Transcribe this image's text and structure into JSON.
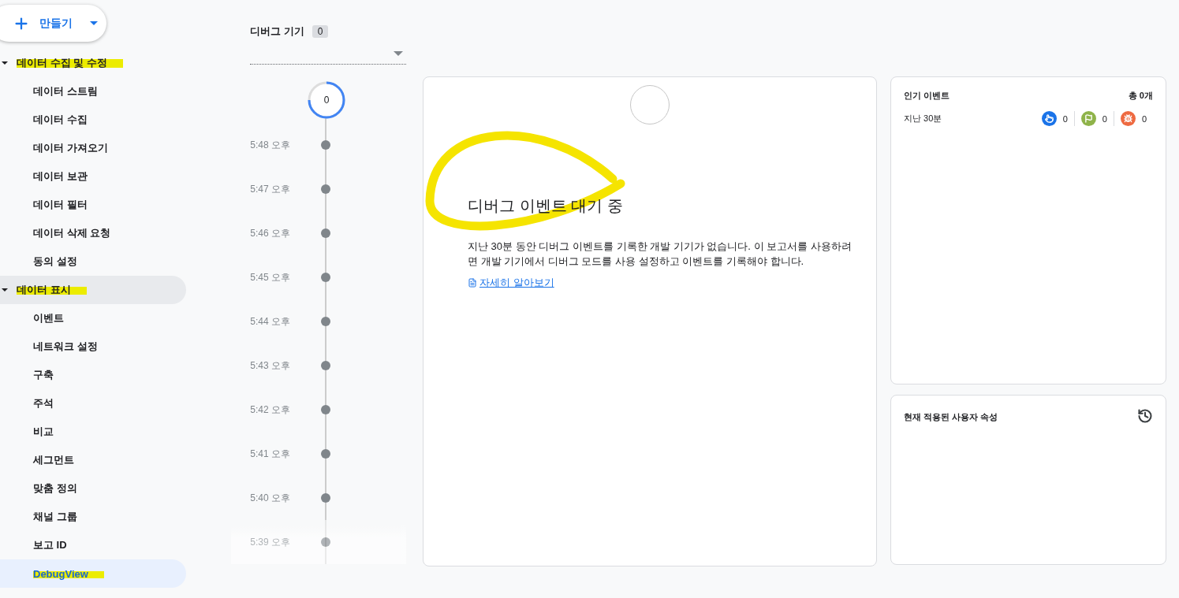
{
  "create_button": {
    "label": "만들기"
  },
  "nav": [
    {
      "label": "데이터 수집 및 수정",
      "expanded": true,
      "hovered": false,
      "marked": true,
      "children": [
        {
          "label": "데이터 스트림",
          "selected": false,
          "marked": false
        },
        {
          "label": "데이터 수집",
          "selected": false,
          "marked": false
        },
        {
          "label": "데이터 가져오기",
          "selected": false,
          "marked": false
        },
        {
          "label": "데이터 보관",
          "selected": false,
          "marked": false
        },
        {
          "label": "데이터 필터",
          "selected": false,
          "marked": false
        },
        {
          "label": "데이터 삭제 요청",
          "selected": false,
          "marked": false
        },
        {
          "label": "동의 설정",
          "selected": false,
          "marked": false
        }
      ]
    },
    {
      "label": "데이터 표시",
      "expanded": true,
      "hovered": true,
      "marked": true,
      "children": [
        {
          "label": "이벤트",
          "selected": false,
          "marked": false
        },
        {
          "label": "네트워크 설정",
          "selected": false,
          "marked": false
        },
        {
          "label": "구축",
          "selected": false,
          "marked": false
        },
        {
          "label": "주석",
          "selected": false,
          "marked": false
        },
        {
          "label": "비교",
          "selected": false,
          "marked": false
        },
        {
          "label": "세그먼트",
          "selected": false,
          "marked": false
        },
        {
          "label": "맞춤 정의",
          "selected": false,
          "marked": false
        },
        {
          "label": "채널 그룹",
          "selected": false,
          "marked": false
        },
        {
          "label": "보고 ID",
          "selected": false,
          "marked": false
        },
        {
          "label": "DebugView",
          "selected": true,
          "marked": true
        }
      ]
    }
  ],
  "debug_devices": {
    "label": "디버그 기기",
    "count": "0"
  },
  "timeline": {
    "count": "0",
    "times": [
      {
        "label": "5:48 오후",
        "faded": false
      },
      {
        "label": "5:47 오후",
        "faded": false
      },
      {
        "label": "5:46 오후",
        "faded": false
      },
      {
        "label": "5:45 오후",
        "faded": false
      },
      {
        "label": "5:44 오후",
        "faded": false
      },
      {
        "label": "5:43 오후",
        "faded": false
      },
      {
        "label": "5:42 오후",
        "faded": false
      },
      {
        "label": "5:41 오후",
        "faded": false
      },
      {
        "label": "5:40 오후",
        "faded": false
      },
      {
        "label": "5:39 오후",
        "faded": true
      }
    ]
  },
  "waiting": {
    "heading": "디버그 이벤트 대기 중",
    "marked": true,
    "body": "지난 30분 동안 디버그 이벤트를 기록한 개발 기기가 없습니다. 이 보고서를 사용하려면 개발 기기에서 디버그 모드를 사용 설정하고 이벤트를 기록해야 합니다.",
    "link": "자세히 알아보기"
  },
  "top_events": {
    "title": "인기 이벤트",
    "total": "총 0개",
    "period": "지난 30분",
    "counters": [
      {
        "kind": "click",
        "color": "#1a73e8",
        "value": "0"
      },
      {
        "kind": "conversion",
        "color": "#8fb34a",
        "value": "0"
      },
      {
        "kind": "error",
        "color": "#ee6a41",
        "value": "0"
      }
    ]
  },
  "user_properties": {
    "title": "현재 적용된 사용자 속성"
  }
}
